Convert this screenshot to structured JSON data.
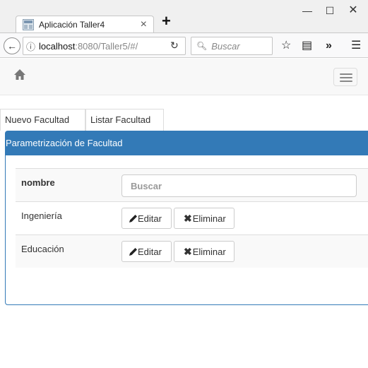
{
  "browser": {
    "tab_title": "Aplicación Taller4",
    "url_host": "localhost",
    "url_path": ":8080/Taller5/#/",
    "search_placeholder": "Buscar"
  },
  "page": {
    "tabs": [
      {
        "label": "Nuevo Facultad"
      },
      {
        "label": "Listar Facultad"
      }
    ],
    "panel_title": "Parametrización de Facultad",
    "table": {
      "header": "nombre",
      "search_placeholder": "Buscar",
      "rows": [
        {
          "nombre": "Ingeniería",
          "edit_label": "Editar",
          "delete_label": "Eliminar"
        },
        {
          "nombre": "Educación",
          "edit_label": "Editar",
          "delete_label": "Eliminar"
        }
      ]
    }
  },
  "colors": {
    "panel_primary": "#337ab7",
    "navbar_bg": "#f8f8f8"
  },
  "icons": [
    "home-icon",
    "hamburger-menu-icon",
    "pencil-icon",
    "remove-icon"
  ]
}
